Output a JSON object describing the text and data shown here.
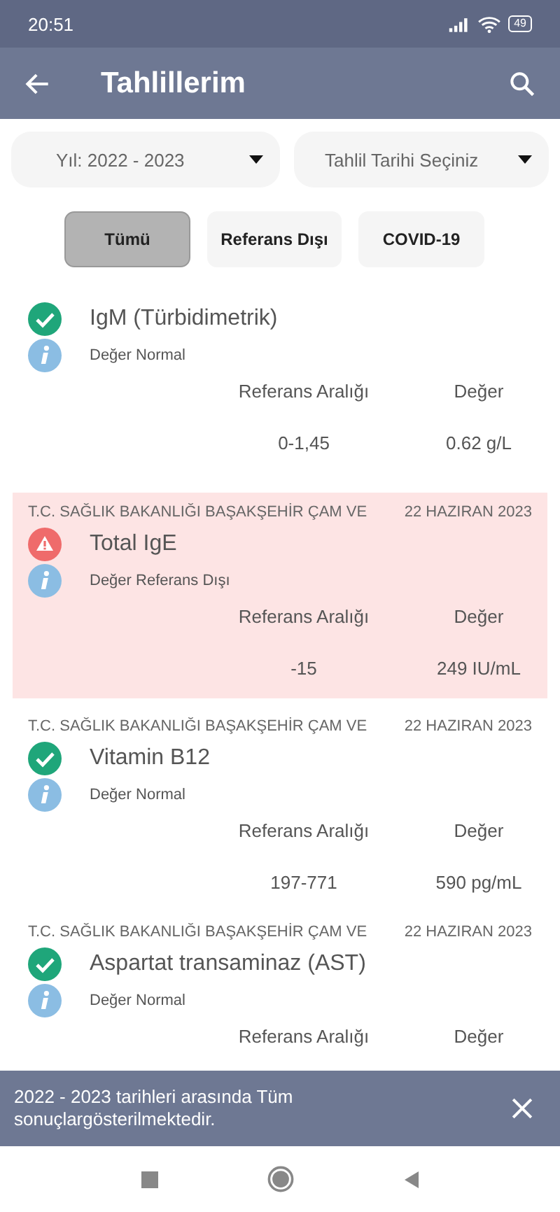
{
  "status_bar": {
    "time": "20:51",
    "battery": "49"
  },
  "app_bar": {
    "title": "Tahlillerim"
  },
  "filters": [
    {
      "label": "Yıl: 2022 - 2023"
    },
    {
      "label": "Tahlil Tarihi Seçiniz"
    }
  ],
  "tabs": [
    {
      "label": "Tümü",
      "selected": true
    },
    {
      "label": "Referans Dışı",
      "selected": false
    },
    {
      "label": "COVID-19",
      "selected": false
    }
  ],
  "results": [
    {
      "test": "IgM (Türbidimetrik)",
      "kind": "normal",
      "status_text": "Değer Normal",
      "range_label": "Referans Aralığı",
      "value_label": "Değer",
      "range": "0-1,45",
      "value": "0.62 g/L"
    },
    {
      "institution": "T.C. SAĞLIK BAKANLIĞI BAŞAKŞEHİR ÇAM VE",
      "date": "22 HAZIRAN 2023",
      "test": "Total IgE",
      "kind": "out_of_range",
      "status_text": "Değer Referans Dışı",
      "range_label": "Referans Aralığı",
      "value_label": "Değer",
      "range": "-15",
      "value": "249 IU/mL"
    },
    {
      "institution": "T.C. SAĞLIK BAKANLIĞI BAŞAKŞEHİR ÇAM VE",
      "date": "22 HAZIRAN 2023",
      "test": "Vitamin B12",
      "kind": "normal",
      "status_text": "Değer Normal",
      "range_label": "Referans Aralığı",
      "value_label": "Değer",
      "range": "197-771",
      "value": "590 pg/mL"
    },
    {
      "institution": "T.C. SAĞLIK BAKANLIĞI BAŞAKŞEHİR ÇAM VE",
      "date": "22 HAZIRAN 2023",
      "test": "Aspartat transaminaz (AST)",
      "kind": "normal",
      "status_text": "Değer Normal",
      "range_label": "Referans Aralığı",
      "value_label": "Değer"
    }
  ],
  "snackbar": {
    "message": "2022 - 2023 tarihleri arasında Tüm sonuçlargösterilmektedir."
  }
}
